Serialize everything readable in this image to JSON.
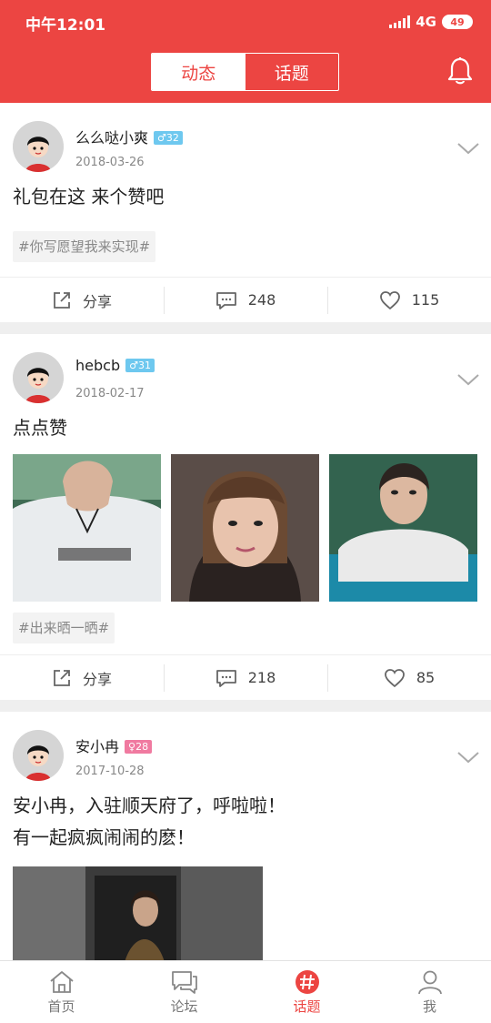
{
  "status": {
    "time": "中午12:01",
    "network": "4G",
    "battery": "49"
  },
  "header": {
    "tabs": [
      {
        "label": "动态",
        "active": true
      },
      {
        "label": "话题",
        "active": false
      }
    ]
  },
  "posts": [
    {
      "username": "么么哒小爽",
      "gender": "male",
      "badge": "♂32",
      "date": "2018-03-26",
      "text": "礼包在这 来个赞吧",
      "tag": "#你写愿望我来实现#",
      "share_label": "分享",
      "comments": "248",
      "likes": "115"
    },
    {
      "username": "hebcb",
      "gender": "male",
      "badge": "♂31",
      "date": "2018-02-17",
      "text": "点点赞",
      "tag": "#出来晒一晒#",
      "share_label": "分享",
      "comments": "218",
      "likes": "85"
    },
    {
      "username": "安小冉",
      "gender": "female",
      "badge": "♀28",
      "date": "2017-10-28",
      "text_line1": "安小冉，入驻顺天府了，呼啦啦！",
      "text_line2": "有一起疯疯闹闹的麽！"
    }
  ],
  "nav": [
    {
      "label": "首页",
      "icon": "home-icon",
      "active": false
    },
    {
      "label": "论坛",
      "icon": "forum-icon",
      "active": false
    },
    {
      "label": "话题",
      "icon": "topic-hash-icon",
      "active": true
    },
    {
      "label": "我",
      "icon": "profile-icon",
      "active": false
    }
  ],
  "colors": {
    "brand": "#ec4542",
    "male_badge": "#6ec8ef",
    "female_badge": "#f07aa0"
  }
}
